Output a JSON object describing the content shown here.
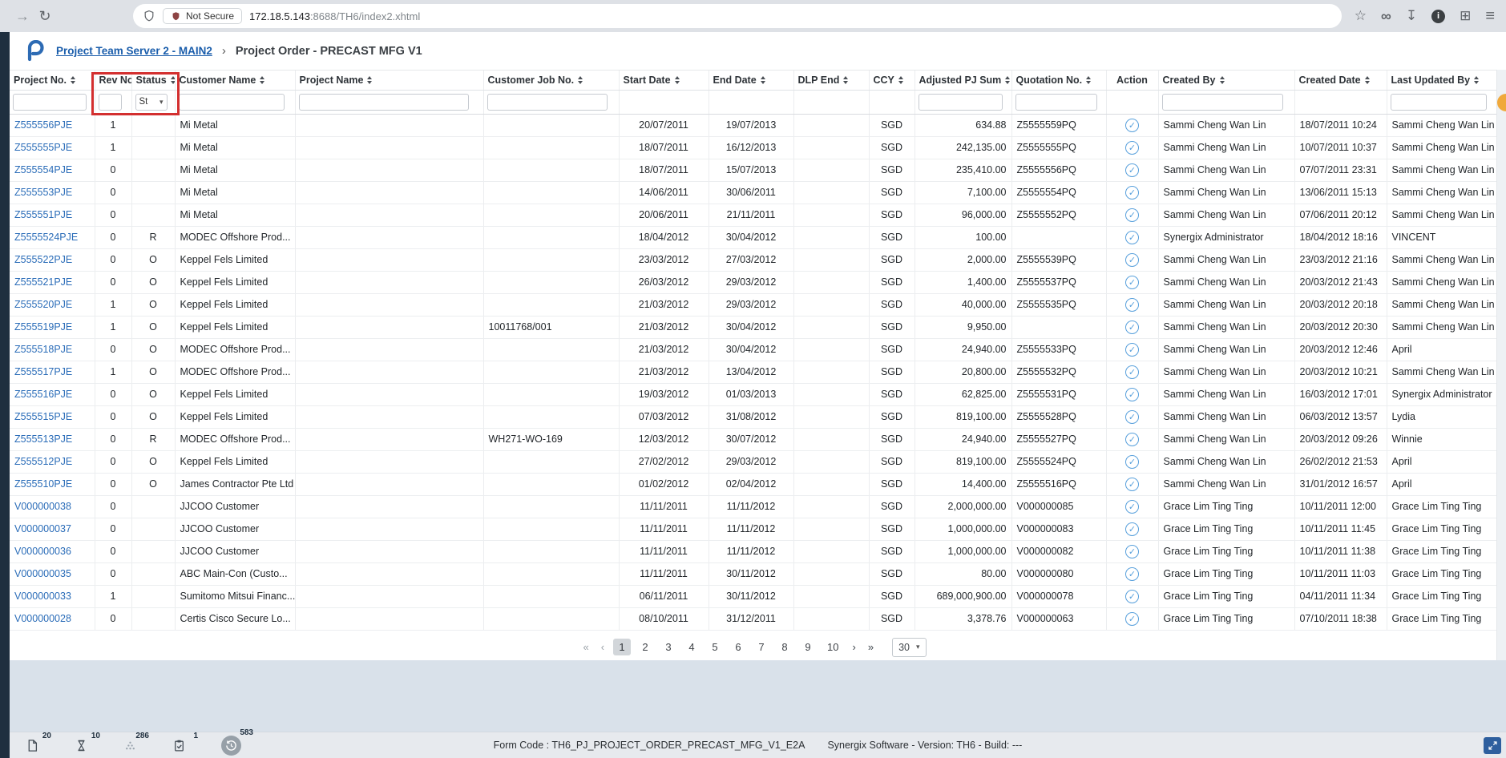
{
  "browser": {
    "nav": {
      "forward_icon": "→",
      "reload_icon": "↻"
    },
    "security_chip": {
      "label": "Not Secure"
    },
    "url": {
      "host": "172.18.5.143",
      "path": ":8688/TH6/index2.xhtml"
    },
    "actions": {
      "star_icon": "☆",
      "infinity_icon": "∞",
      "download_icon": "↧",
      "info_icon": "i",
      "extensions_icon": "⊞",
      "menu_icon": "≡"
    }
  },
  "header": {
    "breadcrumb_root": "Project Team Server 2 - MAIN2",
    "breadcrumb_separator": "›",
    "page_title": "Project Order - PRECAST MFG V1"
  },
  "table": {
    "action_icon": "✓",
    "status_filter_value": "St",
    "select_chevron": "▾",
    "columns": [
      {
        "key": "project_no",
        "label": "Project No.",
        "sort": true,
        "filter": "input",
        "align": "left",
        "link": true
      },
      {
        "key": "rev_no",
        "label": "Rev No.",
        "sort": false,
        "filter": "input",
        "align": "center"
      },
      {
        "key": "status",
        "label": "Status",
        "sort": true,
        "filter": "select",
        "align": "center"
      },
      {
        "key": "customer_name",
        "label": "Customer Name",
        "sort": true,
        "filter": "input",
        "align": "left"
      },
      {
        "key": "project_name",
        "label": "Project Name",
        "sort": true,
        "filter": "input",
        "align": "left"
      },
      {
        "key": "customer_job_no",
        "label": "Customer Job No.",
        "sort": true,
        "filter": "input",
        "align": "left"
      },
      {
        "key": "start_date",
        "label": "Start Date",
        "sort": true,
        "filter": null,
        "align": "center"
      },
      {
        "key": "end_date",
        "label": "End Date",
        "sort": true,
        "filter": null,
        "align": "center"
      },
      {
        "key": "dlp_end",
        "label": "DLP End",
        "sort": true,
        "filter": null,
        "align": "center"
      },
      {
        "key": "ccy",
        "label": "CCY",
        "sort": true,
        "filter": null,
        "align": "center"
      },
      {
        "key": "adjusted_pj_sum",
        "label": "Adjusted PJ Sum",
        "sort": true,
        "filter": "input",
        "align": "right"
      },
      {
        "key": "quotation_no",
        "label": "Quotation No.",
        "sort": true,
        "filter": "input",
        "align": "left"
      },
      {
        "key": "action",
        "label": "Action",
        "sort": false,
        "filter": null,
        "align": "center",
        "type": "action"
      },
      {
        "key": "created_by",
        "label": "Created By",
        "sort": true,
        "filter": "input",
        "align": "left"
      },
      {
        "key": "created_date",
        "label": "Created Date",
        "sort": true,
        "filter": null,
        "align": "left"
      },
      {
        "key": "last_updated_by",
        "label": "Last Updated By",
        "sort": true,
        "filter": "input",
        "align": "left"
      }
    ],
    "rows": [
      [
        "Z555556PJE",
        "1",
        "",
        "Mi Metal",
        "",
        "",
        "20/07/2011",
        "19/07/2013",
        "",
        "SGD",
        "634.88",
        "Z5555559PQ",
        "",
        "Sammi Cheng Wan Lin",
        "18/07/2011 10:24",
        "Sammi Cheng Wan Lin"
      ],
      [
        "Z555555PJE",
        "1",
        "",
        "Mi Metal",
        "",
        "",
        "18/07/2011",
        "16/12/2013",
        "",
        "SGD",
        "242,135.00",
        "Z5555555PQ",
        "",
        "Sammi Cheng Wan Lin",
        "10/07/2011 10:37",
        "Sammi Cheng Wan Lin"
      ],
      [
        "Z555554PJE",
        "0",
        "",
        "Mi Metal",
        "",
        "",
        "18/07/2011",
        "15/07/2013",
        "",
        "SGD",
        "235,410.00",
        "Z5555556PQ",
        "",
        "Sammi Cheng Wan Lin",
        "07/07/2011 23:31",
        "Sammi Cheng Wan Lin"
      ],
      [
        "Z555553PJE",
        "0",
        "",
        "Mi Metal",
        "",
        "",
        "14/06/2011",
        "30/06/2011",
        "",
        "SGD",
        "7,100.00",
        "Z5555554PQ",
        "",
        "Sammi Cheng Wan Lin",
        "13/06/2011 15:13",
        "Sammi Cheng Wan Lin"
      ],
      [
        "Z555551PJE",
        "0",
        "",
        "Mi Metal",
        "",
        "",
        "20/06/2011",
        "21/11/2011",
        "",
        "SGD",
        "96,000.00",
        "Z5555552PQ",
        "",
        "Sammi Cheng Wan Lin",
        "07/06/2011 20:12",
        "Sammi Cheng Wan Lin"
      ],
      [
        "Z5555524PJE",
        "0",
        "R",
        "MODEC Offshore Prod...",
        "",
        "",
        "18/04/2012",
        "30/04/2012",
        "",
        "SGD",
        "100.00",
        "",
        "",
        "Synergix Administrator",
        "18/04/2012 18:16",
        "VINCENT"
      ],
      [
        "Z555522PJE",
        "0",
        "O",
        "Keppel Fels Limited",
        "",
        "",
        "23/03/2012",
        "27/03/2012",
        "",
        "SGD",
        "2,000.00",
        "Z5555539PQ",
        "",
        "Sammi Cheng Wan Lin",
        "23/03/2012 21:16",
        "Sammi Cheng Wan Lin"
      ],
      [
        "Z555521PJE",
        "0",
        "O",
        "Keppel Fels Limited",
        "",
        "",
        "26/03/2012",
        "29/03/2012",
        "",
        "SGD",
        "1,400.00",
        "Z5555537PQ",
        "",
        "Sammi Cheng Wan Lin",
        "20/03/2012 21:43",
        "Sammi Cheng Wan Lin"
      ],
      [
        "Z555520PJE",
        "1",
        "O",
        "Keppel Fels Limited",
        "",
        "",
        "21/03/2012",
        "29/03/2012",
        "",
        "SGD",
        "40,000.00",
        "Z5555535PQ",
        "",
        "Sammi Cheng Wan Lin",
        "20/03/2012 20:18",
        "Sammi Cheng Wan Lin"
      ],
      [
        "Z555519PJE",
        "1",
        "O",
        "Keppel Fels Limited",
        "",
        "10011768/001",
        "21/03/2012",
        "30/04/2012",
        "",
        "SGD",
        "9,950.00",
        "",
        "",
        "Sammi Cheng Wan Lin",
        "20/03/2012 20:30",
        "Sammi Cheng Wan Lin"
      ],
      [
        "Z555518PJE",
        "0",
        "O",
        "MODEC Offshore Prod...",
        "",
        "",
        "21/03/2012",
        "30/04/2012",
        "",
        "SGD",
        "24,940.00",
        "Z5555533PQ",
        "",
        "Sammi Cheng Wan Lin",
        "20/03/2012 12:46",
        "April"
      ],
      [
        "Z555517PJE",
        "1",
        "O",
        "MODEC Offshore Prod...",
        "",
        "",
        "21/03/2012",
        "13/04/2012",
        "",
        "SGD",
        "20,800.00",
        "Z5555532PQ",
        "",
        "Sammi Cheng Wan Lin",
        "20/03/2012 10:21",
        "Sammi Cheng Wan Lin"
      ],
      [
        "Z555516PJE",
        "0",
        "O",
        "Keppel Fels Limited",
        "",
        "",
        "19/03/2012",
        "01/03/2013",
        "",
        "SGD",
        "62,825.00",
        "Z5555531PQ",
        "",
        "Sammi Cheng Wan Lin",
        "16/03/2012 17:01",
        "Synergix Administrator"
      ],
      [
        "Z555515PJE",
        "0",
        "O",
        "Keppel Fels Limited",
        "",
        "",
        "07/03/2012",
        "31/08/2012",
        "",
        "SGD",
        "819,100.00",
        "Z5555528PQ",
        "",
        "Sammi Cheng Wan Lin",
        "06/03/2012 13:57",
        "Lydia"
      ],
      [
        "Z555513PJE",
        "0",
        "R",
        "MODEC Offshore Prod...",
        "",
        "WH271-WO-169",
        "12/03/2012",
        "30/07/2012",
        "",
        "SGD",
        "24,940.00",
        "Z5555527PQ",
        "",
        "Sammi Cheng Wan Lin",
        "20/03/2012 09:26",
        "Winnie"
      ],
      [
        "Z555512PJE",
        "0",
        "O",
        "Keppel Fels Limited",
        "",
        "",
        "27/02/2012",
        "29/03/2012",
        "",
        "SGD",
        "819,100.00",
        "Z5555524PQ",
        "",
        "Sammi Cheng Wan Lin",
        "26/02/2012 21:53",
        "April"
      ],
      [
        "Z555510PJE",
        "0",
        "O",
        "James Contractor Pte Ltd",
        "",
        "",
        "01/02/2012",
        "02/04/2012",
        "",
        "SGD",
        "14,400.00",
        "Z5555516PQ",
        "",
        "Sammi Cheng Wan Lin",
        "31/01/2012 16:57",
        "April"
      ],
      [
        "V000000038",
        "0",
        "",
        "JJCOO Customer",
        "",
        "",
        "11/11/2011",
        "11/11/2012",
        "",
        "SGD",
        "2,000,000.00",
        "V000000085",
        "",
        "Grace Lim Ting Ting",
        "10/11/2011 12:00",
        "Grace Lim Ting Ting"
      ],
      [
        "V000000037",
        "0",
        "",
        "JJCOO Customer",
        "",
        "",
        "11/11/2011",
        "11/11/2012",
        "",
        "SGD",
        "1,000,000.00",
        "V000000083",
        "",
        "Grace Lim Ting Ting",
        "10/11/2011 11:45",
        "Grace Lim Ting Ting"
      ],
      [
        "V000000036",
        "0",
        "",
        "JJCOO Customer",
        "",
        "",
        "11/11/2011",
        "11/11/2012",
        "",
        "SGD",
        "1,000,000.00",
        "V000000082",
        "",
        "Grace Lim Ting Ting",
        "10/11/2011 11:38",
        "Grace Lim Ting Ting"
      ],
      [
        "V000000035",
        "0",
        "",
        "ABC Main-Con (Custo...",
        "",
        "",
        "11/11/2011",
        "30/11/2012",
        "",
        "SGD",
        "80.00",
        "V000000080",
        "",
        "Grace Lim Ting Ting",
        "10/11/2011 11:03",
        "Grace Lim Ting Ting"
      ],
      [
        "V000000033",
        "1",
        "",
        "Sumitomo Mitsui Financ...",
        "",
        "",
        "06/11/2011",
        "30/11/2012",
        "",
        "SGD",
        "689,000,900.00",
        "V000000078",
        "",
        "Grace Lim Ting Ting",
        "04/11/2011 11:34",
        "Grace Lim Ting Ting"
      ],
      [
        "V000000028",
        "0",
        "",
        "Certis Cisco Secure Lo...",
        "",
        "",
        "08/10/2011",
        "31/12/2011",
        "",
        "SGD",
        "3,378.76",
        "V000000063",
        "",
        "Grace Lim Ting Ting",
        "07/10/2011 18:38",
        "Grace Lim Ting Ting"
      ]
    ]
  },
  "pagination": {
    "first_icon": "«",
    "prev_icon": "‹",
    "next_icon": "›",
    "last_icon": "»",
    "pages": [
      "1",
      "2",
      "3",
      "4",
      "5",
      "6",
      "7",
      "8",
      "9",
      "10"
    ],
    "active_page": "1",
    "page_size": "30",
    "select_chevron": "▾"
  },
  "status_bar": {
    "badges": [
      {
        "name": "document",
        "count": "20"
      },
      {
        "name": "hourglass",
        "count": "10"
      },
      {
        "name": "grid-dots",
        "count": "286"
      },
      {
        "name": "clipboard-check",
        "count": "1"
      },
      {
        "name": "history",
        "count": "583"
      }
    ],
    "form_code": "Form Code : TH6_PJ_PROJECT_ORDER_PRECAST_MFG_V1_E2A",
    "version_text": "Synergix Software - Version: TH6 - Build: ---"
  }
}
